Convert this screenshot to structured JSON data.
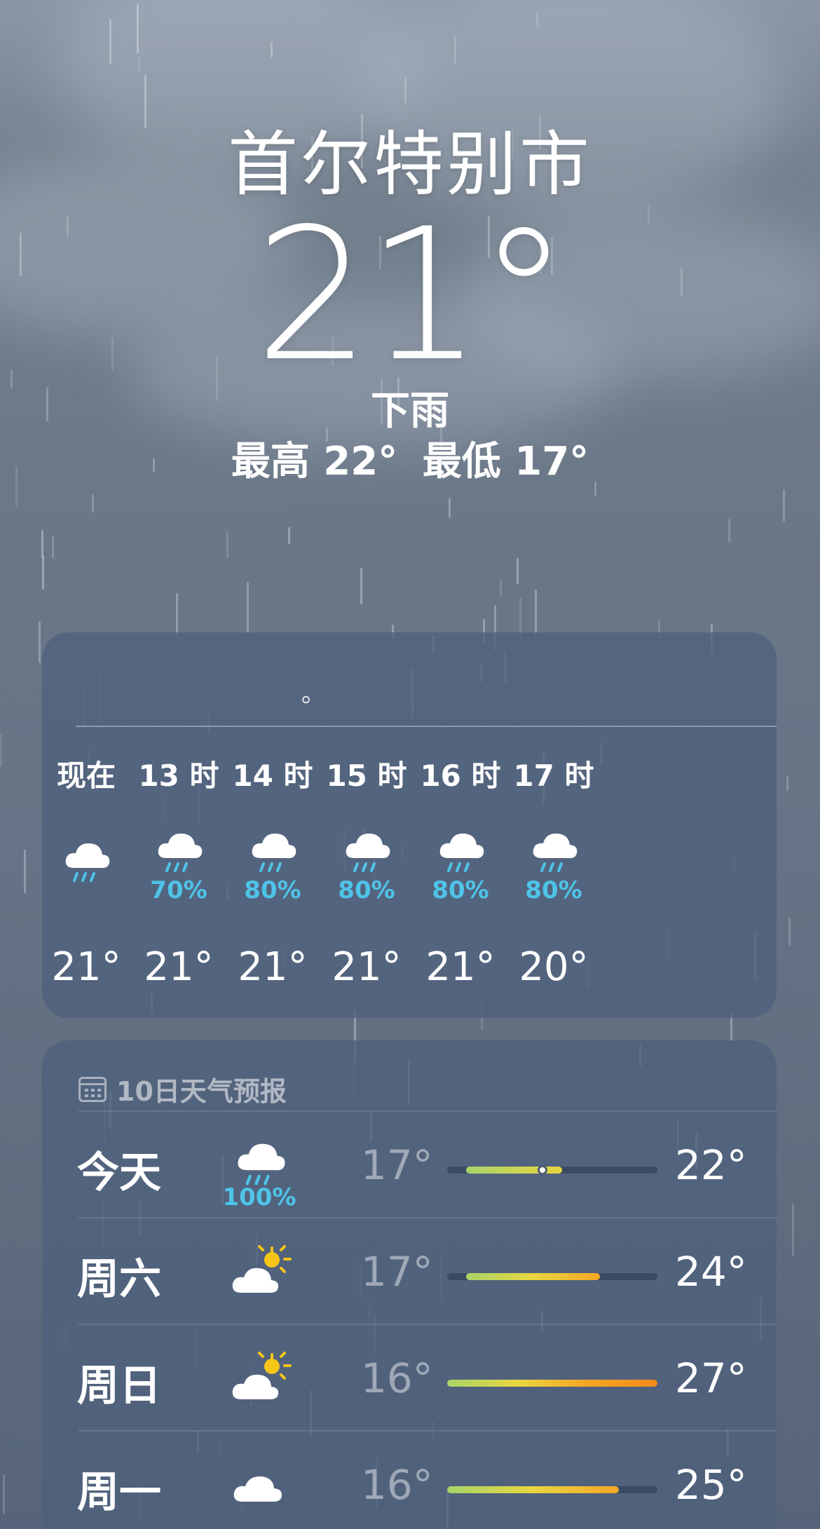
{
  "location": {
    "city": "首尔特别市",
    "temperature": "21°",
    "condition": "下雨",
    "high": "最高 22°",
    "low": "最低 17°"
  },
  "hourly": {
    "summary": "。",
    "items": [
      {
        "label": "现在",
        "icon": "rain-cloud-icon",
        "precip": "",
        "temp": "21°"
      },
      {
        "label": "13 时",
        "icon": "rain-cloud-icon",
        "precip": "70%",
        "temp": "21°"
      },
      {
        "label": "14 时",
        "icon": "rain-cloud-icon",
        "precip": "80%",
        "temp": "21°"
      },
      {
        "label": "15 时",
        "icon": "rain-cloud-icon",
        "precip": "80%",
        "temp": "21°"
      },
      {
        "label": "16 时",
        "icon": "rain-cloud-icon",
        "precip": "80%",
        "temp": "21°"
      },
      {
        "label": "17 时",
        "icon": "rain-cloud-icon",
        "precip": "80%",
        "temp": "20°"
      }
    ]
  },
  "daily": {
    "title": "10日天气预报",
    "range_min": 16,
    "range_max": 27,
    "current_temp": 21,
    "days": [
      {
        "name": "今天",
        "icon": "rain-cloud-icon",
        "precip": "100%",
        "low": "17°",
        "high": "22°",
        "low_value": 17,
        "high_value": 22,
        "show_current": true
      },
      {
        "name": "周六",
        "icon": "partly-sunny-icon",
        "precip": "",
        "low": "17°",
        "high": "24°",
        "low_value": 17,
        "high_value": 24,
        "show_current": false
      },
      {
        "name": "周日",
        "icon": "partly-sunny-icon",
        "precip": "",
        "low": "16°",
        "high": "27°",
        "low_value": 16,
        "high_value": 27,
        "show_current": false
      },
      {
        "name": "周一",
        "icon": "cloud-icon",
        "precip": "",
        "low": "16°",
        "high": "25°",
        "low_value": 16,
        "high_value": 25,
        "show_current": false
      }
    ]
  },
  "colors": {
    "precip": "#4fc3e8",
    "bar_cool": "#a8d46a",
    "bar_mild": "#e8d640",
    "bar_warm": "#f5a623",
    "bar_hot": "#f28a1c"
  }
}
